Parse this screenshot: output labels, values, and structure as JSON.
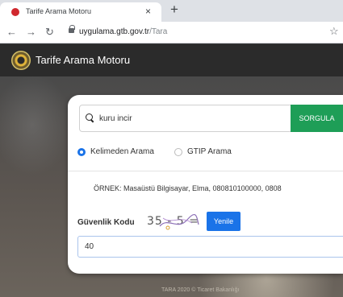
{
  "browser": {
    "tab_title": "Tarife Arama Motoru",
    "tab_close": "×",
    "new_tab": "+",
    "url_host": "uygulama.gtb.gov.tr",
    "url_path": "/Tara",
    "icons": [
      "back-icon",
      "forward-icon",
      "reload-icon",
      "lock-icon",
      "star-icon"
    ]
  },
  "header": {
    "title": "Tarife Arama Motoru"
  },
  "search": {
    "value": "kuru incir",
    "button_label": "SORGULA"
  },
  "search_mode": {
    "options": [
      {
        "label": "Kelimeden Arama",
        "selected": true
      },
      {
        "label": "GTIP Arama",
        "selected": false
      }
    ]
  },
  "example_text": "ÖRNEK: Masaüstü Bilgisayar, Elma, 080810100000, 0808",
  "captcha": {
    "label": "Güvenlik Kodu",
    "image_text": "35 - 5 =",
    "refresh_label": "Yenile",
    "answer": "40"
  },
  "footer": {
    "text": "TARA 2020 © Ticaret Bakanlığı"
  },
  "colors": {
    "primary_button": "#1e9e57",
    "accent_blue": "#1a73e8",
    "header_bg": "#2b2b2b"
  }
}
